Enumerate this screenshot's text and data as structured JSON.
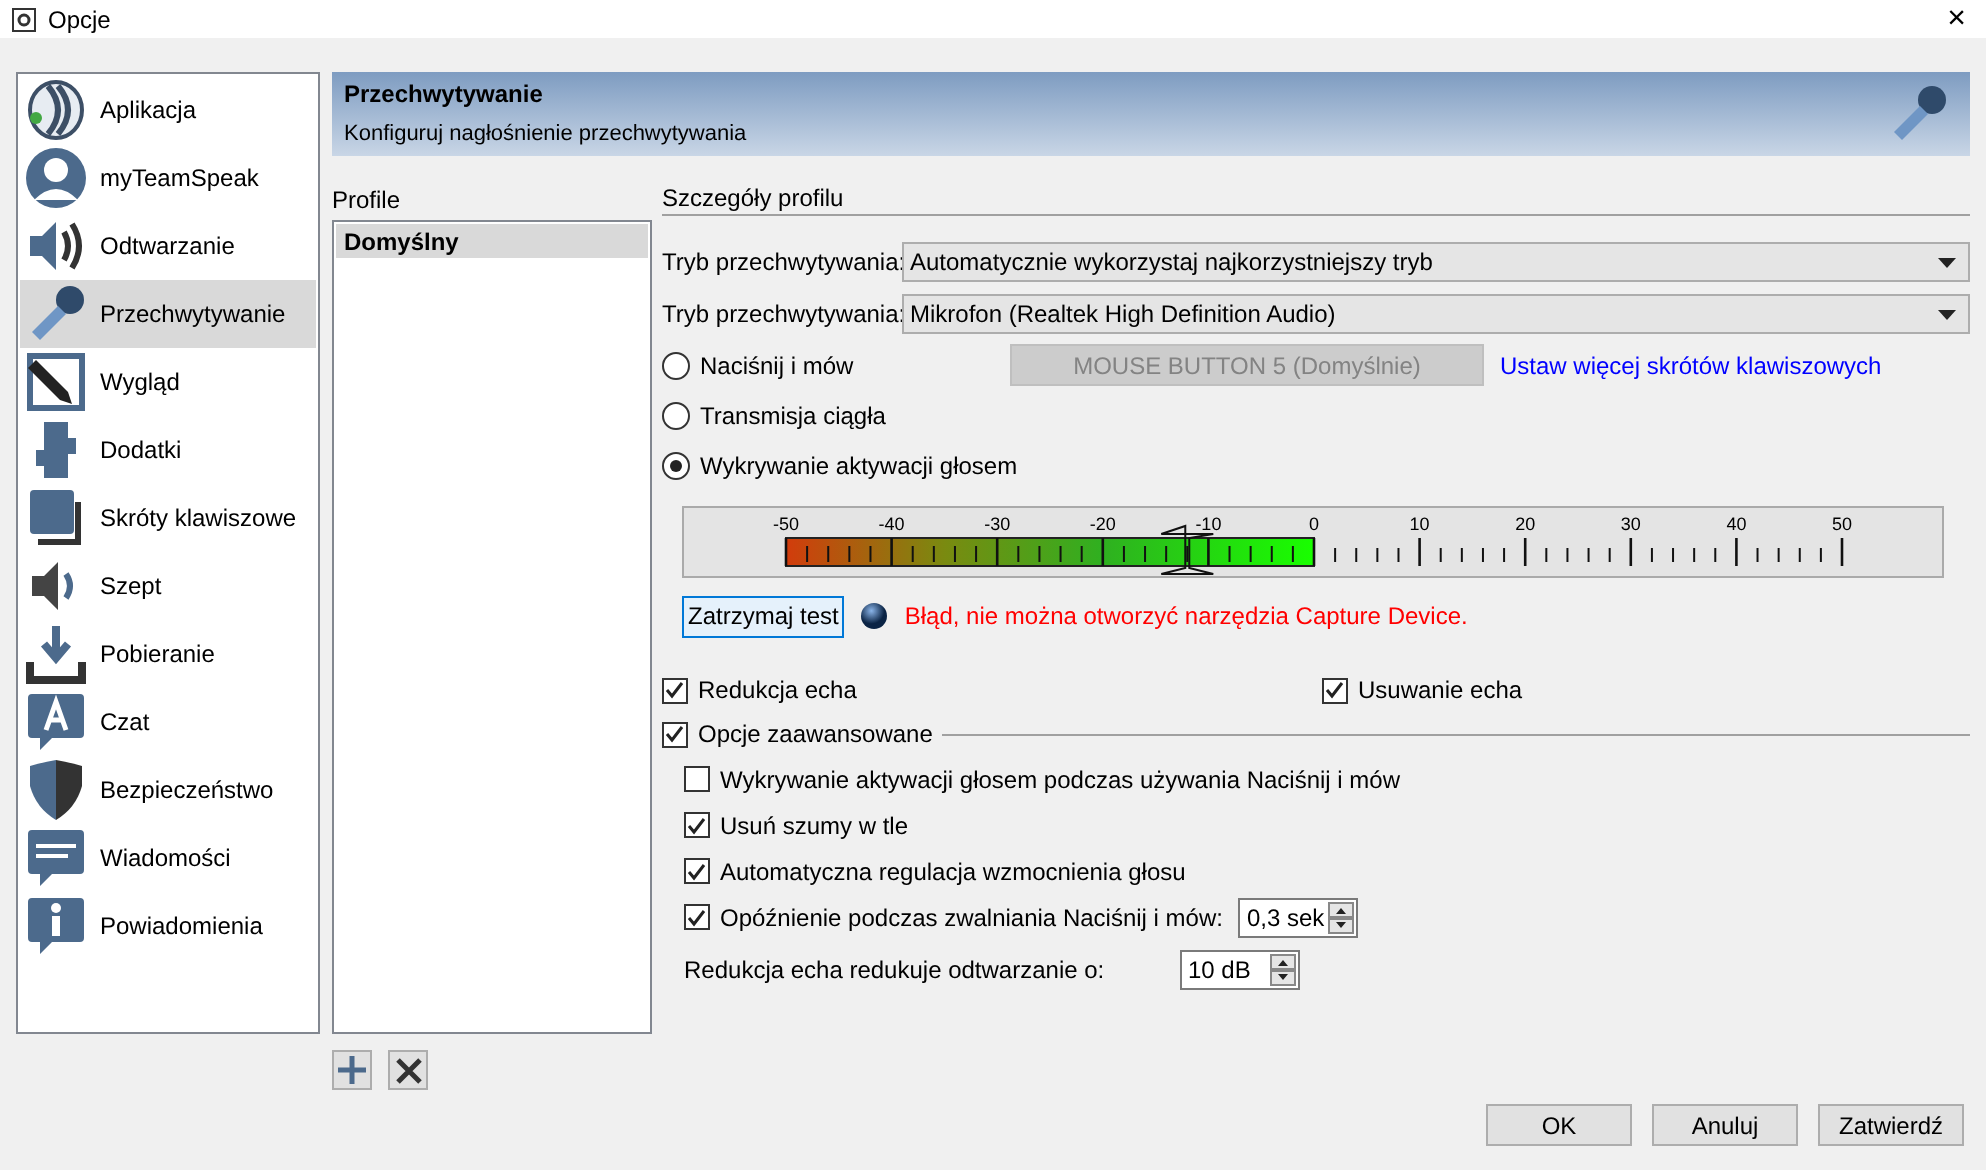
{
  "window": {
    "title": "Opcje",
    "close": "×"
  },
  "sidebar": {
    "items": [
      {
        "label": "Aplikacja",
        "selected": false
      },
      {
        "label": "myTeamSpeak",
        "selected": false
      },
      {
        "label": "Odtwarzanie",
        "selected": false
      },
      {
        "label": "Przechwytywanie",
        "selected": true
      },
      {
        "label": "Wygląd",
        "selected": false
      },
      {
        "label": "Dodatki",
        "selected": false
      },
      {
        "label": "Skróty klawiszowe",
        "selected": false
      },
      {
        "label": "Szept",
        "selected": false
      },
      {
        "label": "Pobieranie",
        "selected": false
      },
      {
        "label": "Czat",
        "selected": false
      },
      {
        "label": "Bezpieczeństwo",
        "selected": false
      },
      {
        "label": "Wiadomości",
        "selected": false
      },
      {
        "label": "Powiadomienia",
        "selected": false
      }
    ]
  },
  "header": {
    "title": "Przechwytywanie",
    "subtitle": "Konfiguruj nagłośnienie przechwytywania"
  },
  "profiles": {
    "label": "Profile",
    "items": [
      {
        "label": "Domyślny",
        "selected": true
      }
    ]
  },
  "details": {
    "title": "Szczegóły profilu",
    "selects": [
      {
        "label": "Tryb przechwytywania:",
        "value": "Automatycznie wykorzystaj najkorzystniejszy tryb"
      },
      {
        "label": "Tryb przechwytywania:",
        "value": "Mikrofon (Realtek High Definition Audio)"
      }
    ],
    "modes": [
      {
        "label": "Naciśnij i mów",
        "selected": false
      },
      {
        "label": "Transmisja ciągła",
        "selected": false
      },
      {
        "label": "Wykrywanie aktywacji głosem",
        "selected": true
      }
    ],
    "hotkey_button": {
      "label": "MOUSE BUTTON 5 (Domyślnie)",
      "disabled": true
    },
    "hotkey_link": "Ustaw więcej skrótów klawiszowych",
    "meter": {
      "scale": [
        "-50",
        "-40",
        "-30",
        "-20",
        "-10",
        "0",
        "10",
        "20",
        "30",
        "40",
        "50"
      ],
      "threshold": {
        "level": 0.38
      }
    },
    "test_button": "Zatrzymaj test",
    "status_message": "Błąd, nie można otworzyć narzędzia Capture Device.",
    "echo": [
      {
        "label": "Redukcja echa",
        "checked": true
      },
      {
        "label": "Usuwanie echa",
        "checked": true
      }
    ],
    "advanced": {
      "label": "Opcje zaawansowane",
      "checked": true,
      "options": [
        {
          "kind": "checkbox",
          "label": "Wykrywanie aktywacji głosem podczas używania Naciśnij i mów",
          "checked": false
        },
        {
          "kind": "checkbox",
          "label": "Usuń szumy w tle",
          "checked": true
        },
        {
          "kind": "checkbox",
          "label": "Automatyczna regulacja wzmocnienia głosu",
          "checked": true
        },
        {
          "kind": "checkbox_spin",
          "label": "Opóźnienie podczas zwalniania Naciśnij i mów:",
          "checked": true,
          "value": "0,3 sek"
        },
        {
          "kind": "spin",
          "label": "Redukcja echa redukuje odtwarzanie o:",
          "value": "10 dB"
        }
      ]
    }
  },
  "dialog_buttons": [
    "OK",
    "Anuluj",
    "Zatwierdź"
  ]
}
